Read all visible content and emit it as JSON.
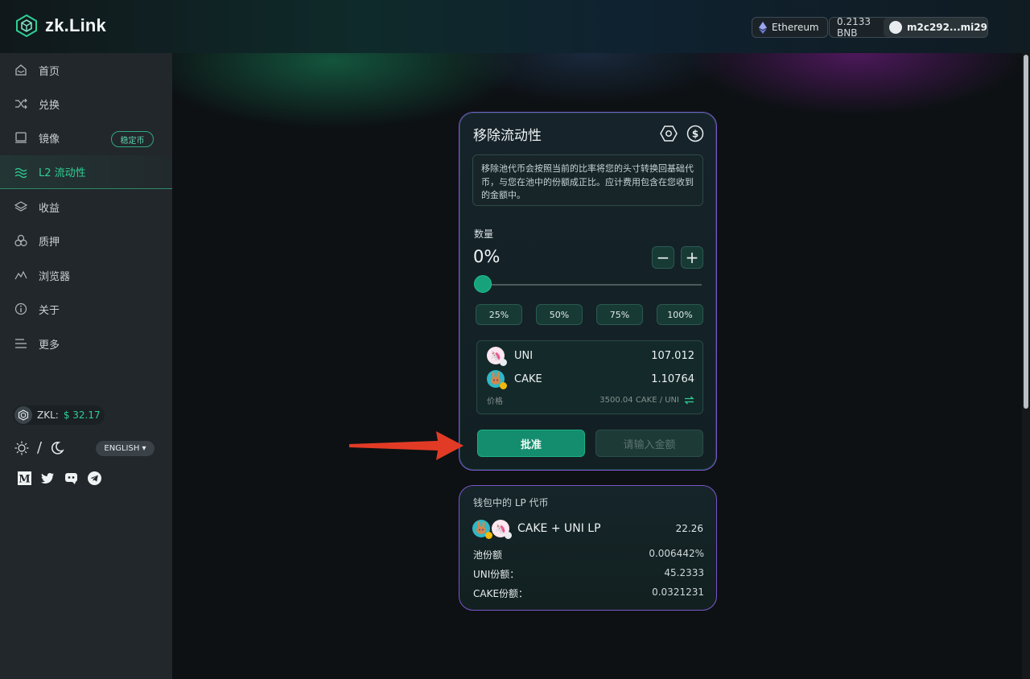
{
  "header": {
    "logo_text": "zk.Link",
    "network": "Ethereum",
    "balance": "0.2133 BNB",
    "address": "m2c292...mi29"
  },
  "sidebar": {
    "items": [
      {
        "label": "首页",
        "icon": "home-icon"
      },
      {
        "label": "兑换",
        "icon": "swap-icon"
      },
      {
        "label": "镜像",
        "icon": "mirror-icon"
      },
      {
        "label": "L2 流动性",
        "icon": "liquidity-icon"
      },
      {
        "label": "收益",
        "icon": "layers-icon"
      },
      {
        "label": "质押",
        "icon": "stake-icon"
      },
      {
        "label": "浏览器",
        "icon": "chart-icon"
      },
      {
        "label": "关于",
        "icon": "info-icon"
      },
      {
        "label": "更多",
        "icon": "menu-icon"
      }
    ],
    "badge": "稳定币",
    "zkl_label": "ZKL:",
    "zkl_price": "$ 32.17",
    "theme_separator": "/",
    "language": "ENGLISH ▾",
    "socials": [
      "medium-icon",
      "twitter-icon",
      "discord-icon",
      "telegram-icon"
    ]
  },
  "remove": {
    "title": "移除流动性",
    "description": "移除池代币会按照当前的比率将您的头寸转换回基础代币，与您在池中的份额成正比。应计费用包含在您收到的金额中。",
    "amount_label": "数量",
    "amount_value": "0%",
    "minus": "−",
    "plus": "+",
    "slider_percent": 0,
    "presets": [
      "25%",
      "50%",
      "75%",
      "100%"
    ],
    "tokens": [
      {
        "symbol": "UNI",
        "amount": "107.012"
      },
      {
        "symbol": "CAKE",
        "amount": "1.10764"
      }
    ],
    "price_label": "价格",
    "price_value": "3500.04 CAKE / UNI",
    "approve_label": "批准",
    "enter_amount_label": "请输入金额"
  },
  "lp": {
    "title": "钱包中的 LP 代币",
    "pair": "CAKE + UNI  LP",
    "amount": "22.26",
    "rows": [
      {
        "label": "池份额",
        "value": "0.006442%"
      },
      {
        "label": "UNI份额：",
        "value": "45.2333"
      },
      {
        "label": "CAKE份额：",
        "value": "0.0321231"
      }
    ]
  },
  "colors": {
    "accent": "#2fcf94",
    "approve_bg": "#138d6e",
    "card_border": "#7a56c9",
    "arrow": "#e23b25"
  }
}
